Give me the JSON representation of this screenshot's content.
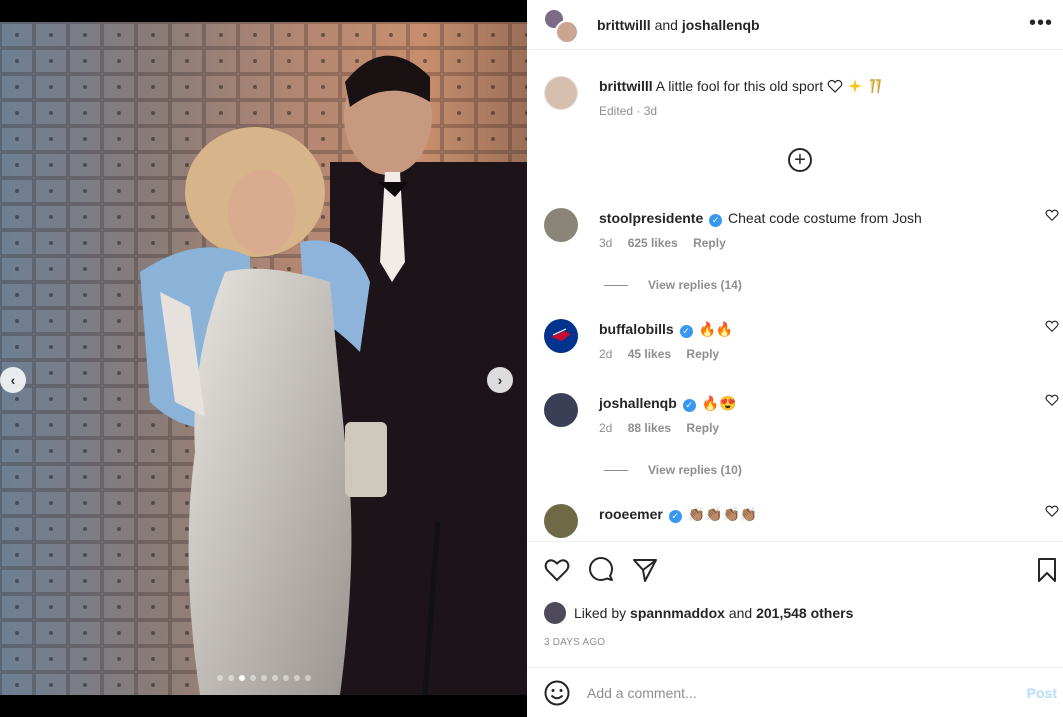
{
  "header": {
    "user1": "brittwilll",
    "and": "and",
    "user2": "joshallenqb",
    "more_icon": "more-horizontal-icon"
  },
  "caption": {
    "user": "brittwilll",
    "text": "A little fool for this old sport",
    "meta": "Edited · 3d"
  },
  "comments": [
    {
      "user": "stoolpresidente",
      "verified": true,
      "text": "Cheat code costume from Josh",
      "time": "3d",
      "likes": "625 likes",
      "reply": "Reply",
      "replies": "View replies (14)",
      "avatar_color": "#8a8578"
    },
    {
      "user": "buffalobills",
      "verified": true,
      "text": "",
      "emoji": "🔥🔥",
      "time": "2d",
      "likes": "45 likes",
      "reply": "Reply",
      "replies": "",
      "avatar_color": "#00338d"
    },
    {
      "user": "joshallenqb",
      "verified": true,
      "text": "",
      "emoji": "🔥😍",
      "time": "2d",
      "likes": "88 likes",
      "reply": "Reply",
      "replies": "View replies (10)",
      "avatar_color": "#3b3f55"
    },
    {
      "user": "rooeemer",
      "verified": true,
      "text": "",
      "emoji": "👏🏽👏🏽👏🏽👏🏽",
      "time": "",
      "likes": "",
      "reply": "",
      "replies": "",
      "avatar_color": "#6d6a45"
    }
  ],
  "actions": {
    "liked_by_prefix": "Liked by",
    "liked_by_user": "spannmaddox",
    "and": "and",
    "others": "201,548 others",
    "time_ago": "3 DAYS AGO"
  },
  "add_comment": {
    "placeholder": "Add a comment...",
    "post_label": "Post"
  },
  "carousel": {
    "prev_icon": "chevron-left-icon",
    "next_icon": "chevron-right-icon",
    "active_index": 2,
    "count": 9
  }
}
